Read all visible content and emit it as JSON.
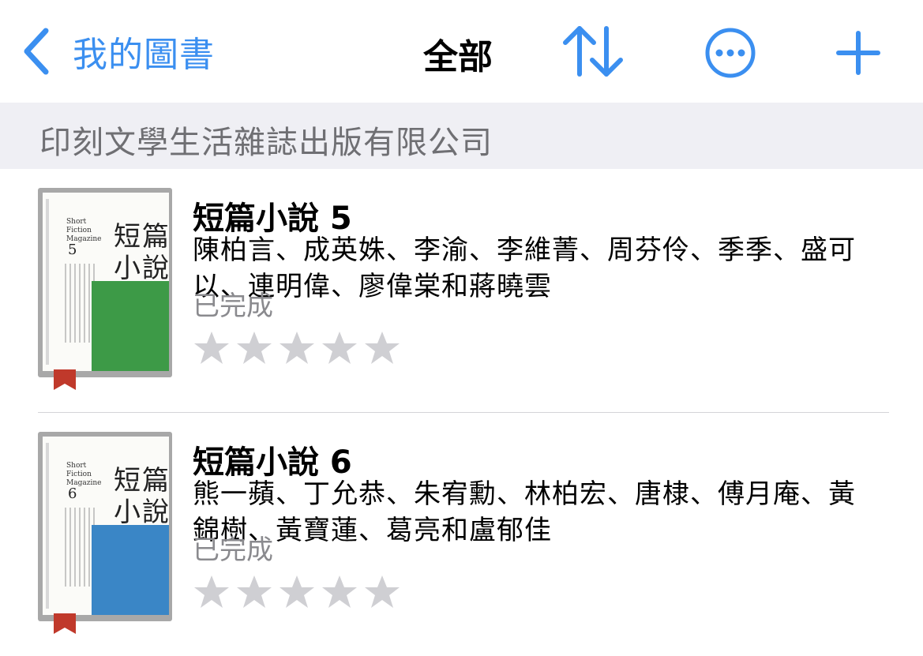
{
  "nav": {
    "back_label": "我的圖書",
    "title": "全部",
    "accent_color": "#3b8ff0",
    "icons": [
      "chevron-left-icon",
      "sort-icon",
      "more-icon",
      "plus-icon"
    ]
  },
  "section": {
    "title": "印刻文學生活雜誌出版有限公司"
  },
  "books": [
    {
      "title": "短篇小說 5",
      "authors": "陳柏言、成英姝、李渝、李維菁、周芬伶、季季、盛可以、連明偉、廖偉棠和蔣曉雲",
      "status": "已完成",
      "rating": 0,
      "cover": {
        "en": "Short Fiction Magazine",
        "title1": "短篇",
        "title2": "小說",
        "number": "5",
        "color": "#3d9a47"
      }
    },
    {
      "title": "短篇小說 6",
      "authors": "熊一蘋、丁允恭、朱宥勳、林柏宏、唐棣、傅月庵、黃錦樹、黃寶蓮、葛亮和盧郁佳",
      "status": "已完成",
      "rating": 0,
      "cover": {
        "en": "Short Fiction Magazine",
        "title1": "短篇",
        "title2": "小說",
        "number": "6",
        "color": "#3a86c6"
      }
    }
  ]
}
